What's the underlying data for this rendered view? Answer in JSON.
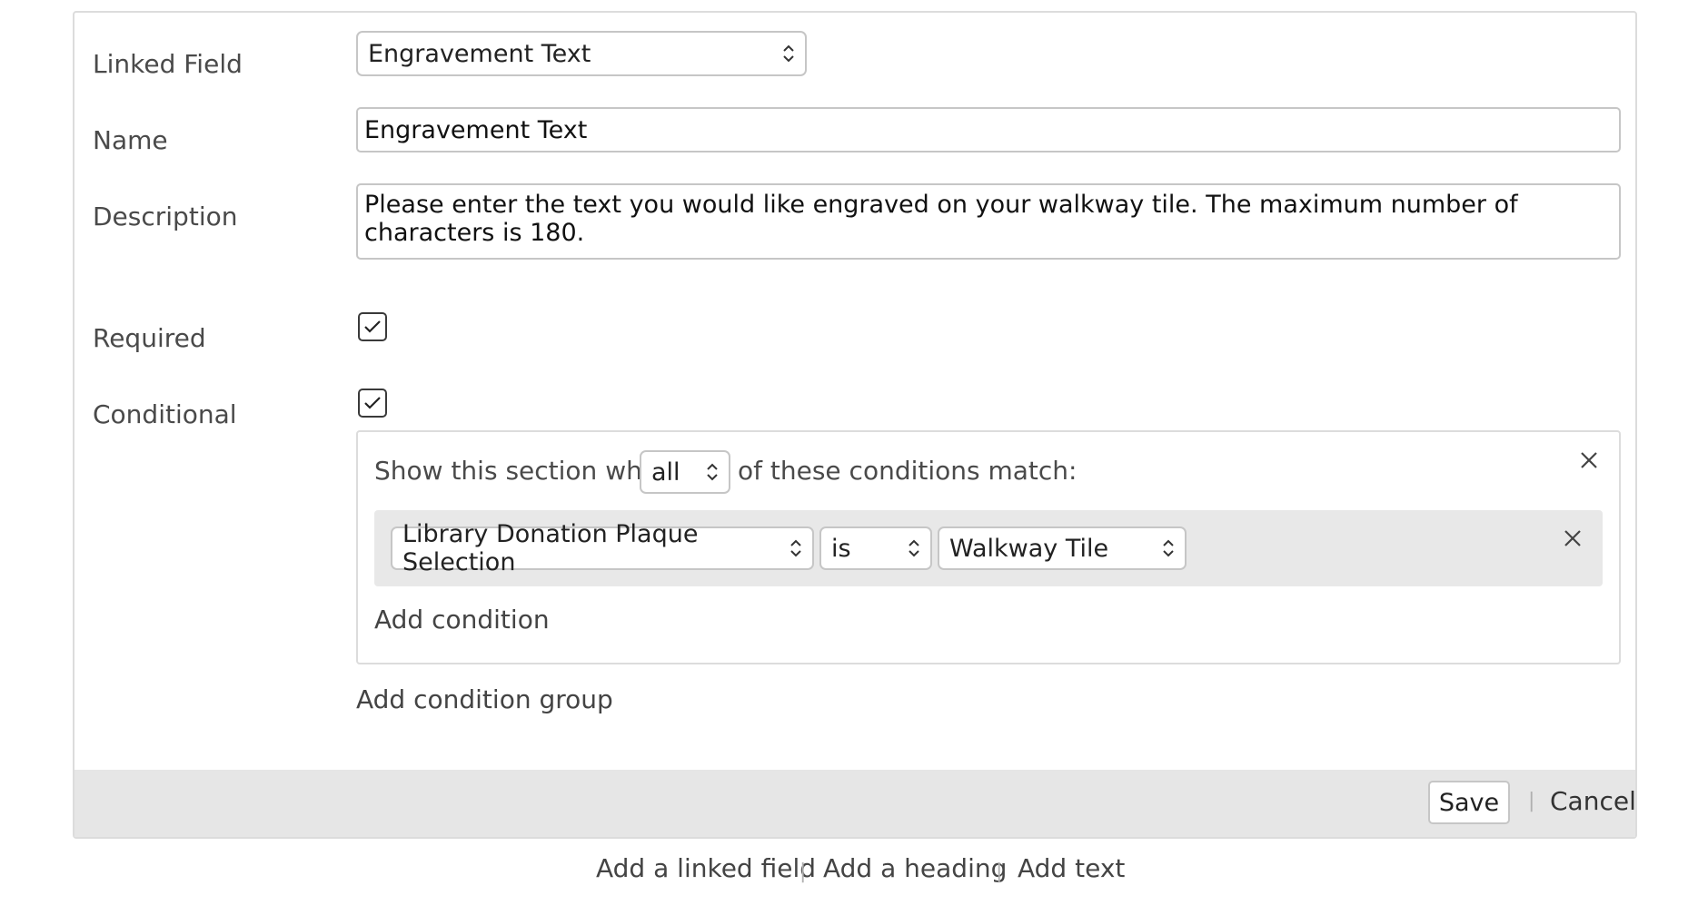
{
  "form": {
    "linked_field": {
      "label": "Linked Field",
      "value": "Engravement Text"
    },
    "name": {
      "label": "Name",
      "value": "Engravement Text"
    },
    "description": {
      "label": "Description",
      "value": "Please enter the text you would like engraved on your walkway tile. The maximum number of characters is 180."
    },
    "required": {
      "label": "Required",
      "checked": true
    },
    "conditional": {
      "label": "Conditional",
      "checked": true
    }
  },
  "conditions": {
    "prefix": "Show this section when",
    "match_mode": "all",
    "suffix": "of these conditions match:",
    "rows": [
      {
        "field": "Library Donation Plaque Selection",
        "operator": "is",
        "value": "Walkway Tile"
      }
    ],
    "add_condition": "Add condition",
    "add_condition_group": "Add condition group"
  },
  "footer": {
    "save": "Save",
    "separator": "|",
    "cancel": "Cancel"
  },
  "bottom_links": {
    "add_linked_field": "Add a linked field",
    "add_heading": "Add a heading",
    "add_text": "Add text",
    "separator": "|"
  },
  "icons": {
    "select_chevron": "up-down-chevron-icon",
    "checkbox": "checkmark-icon",
    "remove": "close-icon"
  }
}
